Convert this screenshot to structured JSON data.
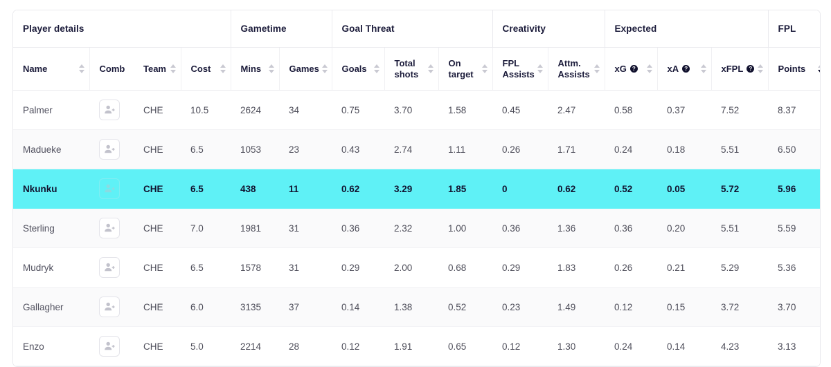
{
  "table": {
    "groups": [
      {
        "label": "Player details",
        "span": 4
      },
      {
        "label": "Gametime",
        "span": 2
      },
      {
        "label": "Goal Threat",
        "span": 3
      },
      {
        "label": "Creativity",
        "span": 2
      },
      {
        "label": "Expected",
        "span": 3
      },
      {
        "label": "FPL",
        "span": 1
      }
    ],
    "columns": [
      {
        "label": "Name",
        "sortable": true,
        "help": false,
        "sorted": "none"
      },
      {
        "label": "Comb",
        "sortable": false,
        "help": false,
        "sorted": "none"
      },
      {
        "label": "Team",
        "sortable": true,
        "help": false,
        "sorted": "none"
      },
      {
        "label": "Cost",
        "sortable": true,
        "help": false,
        "sorted": "none"
      },
      {
        "label": "Mins",
        "sortable": true,
        "help": false,
        "sorted": "none"
      },
      {
        "label": "Games",
        "sortable": true,
        "help": false,
        "sorted": "none"
      },
      {
        "label": "Goals",
        "sortable": true,
        "help": false,
        "sorted": "none"
      },
      {
        "label": "Total\nshots",
        "sortable": true,
        "help": false,
        "sorted": "none"
      },
      {
        "label": "On\ntarget",
        "sortable": true,
        "help": false,
        "sorted": "none"
      },
      {
        "label": "FPL\nAssists",
        "sortable": true,
        "help": false,
        "sorted": "none"
      },
      {
        "label": "Attm.\nAssists",
        "sortable": true,
        "help": false,
        "sorted": "none"
      },
      {
        "label": "xG",
        "sortable": true,
        "help": true,
        "sorted": "none"
      },
      {
        "label": "xA",
        "sortable": true,
        "help": true,
        "sorted": "none"
      },
      {
        "label": "xFPL",
        "sortable": true,
        "help": true,
        "sorted": "none"
      },
      {
        "label": "Points",
        "sortable": true,
        "help": false,
        "sorted": "desc"
      }
    ],
    "help_glyph": "?",
    "add_button_name": "add-player-button",
    "rows": [
      {
        "name": "Palmer",
        "team": "CHE",
        "cost": "10.5",
        "mins": "2624",
        "games": "34",
        "goals": "0.75",
        "total_shots": "3.70",
        "on_target": "1.58",
        "fpl_assists": "0.45",
        "attm_assists": "2.47",
        "xg": "0.58",
        "xa": "0.37",
        "xfpl": "7.52",
        "points": "8.37",
        "selected": false,
        "stripe": false
      },
      {
        "name": "Madueke",
        "team": "CHE",
        "cost": "6.5",
        "mins": "1053",
        "games": "23",
        "goals": "0.43",
        "total_shots": "2.74",
        "on_target": "1.11",
        "fpl_assists": "0.26",
        "attm_assists": "1.71",
        "xg": "0.24",
        "xa": "0.18",
        "xfpl": "5.51",
        "points": "6.50",
        "selected": false,
        "stripe": true
      },
      {
        "name": "Nkunku",
        "team": "CHE",
        "cost": "6.5",
        "mins": "438",
        "games": "11",
        "goals": "0.62",
        "total_shots": "3.29",
        "on_target": "1.85",
        "fpl_assists": "0",
        "attm_assists": "0.62",
        "xg": "0.52",
        "xa": "0.05",
        "xfpl": "5.72",
        "points": "5.96",
        "selected": true,
        "stripe": false
      },
      {
        "name": "Sterling",
        "team": "CHE",
        "cost": "7.0",
        "mins": "1981",
        "games": "31",
        "goals": "0.36",
        "total_shots": "2.32",
        "on_target": "1.00",
        "fpl_assists": "0.36",
        "attm_assists": "1.36",
        "xg": "0.36",
        "xa": "0.20",
        "xfpl": "5.51",
        "points": "5.59",
        "selected": false,
        "stripe": true
      },
      {
        "name": "Mudryk",
        "team": "CHE",
        "cost": "6.5",
        "mins": "1578",
        "games": "31",
        "goals": "0.29",
        "total_shots": "2.00",
        "on_target": "0.68",
        "fpl_assists": "0.29",
        "attm_assists": "1.83",
        "xg": "0.26",
        "xa": "0.21",
        "xfpl": "5.29",
        "points": "5.36",
        "selected": false,
        "stripe": false
      },
      {
        "name": "Gallagher",
        "team": "CHE",
        "cost": "6.0",
        "mins": "3135",
        "games": "37",
        "goals": "0.14",
        "total_shots": "1.38",
        "on_target": "0.52",
        "fpl_assists": "0.23",
        "attm_assists": "1.49",
        "xg": "0.12",
        "xa": "0.15",
        "xfpl": "3.72",
        "points": "3.70",
        "selected": false,
        "stripe": true
      },
      {
        "name": "Enzo",
        "team": "CHE",
        "cost": "5.0",
        "mins": "2214",
        "games": "28",
        "goals": "0.12",
        "total_shots": "1.91",
        "on_target": "0.65",
        "fpl_assists": "0.12",
        "attm_assists": "1.30",
        "xg": "0.24",
        "xa": "0.14",
        "xfpl": "4.23",
        "points": "3.13",
        "selected": false,
        "stripe": false
      }
    ]
  },
  "colors": {
    "selected_row": "#5ff1f6",
    "stripe_row": "#fafafb",
    "header_text": "#1b1b3a",
    "body_text": "#4d4d59",
    "border": "#e9e9ed"
  }
}
